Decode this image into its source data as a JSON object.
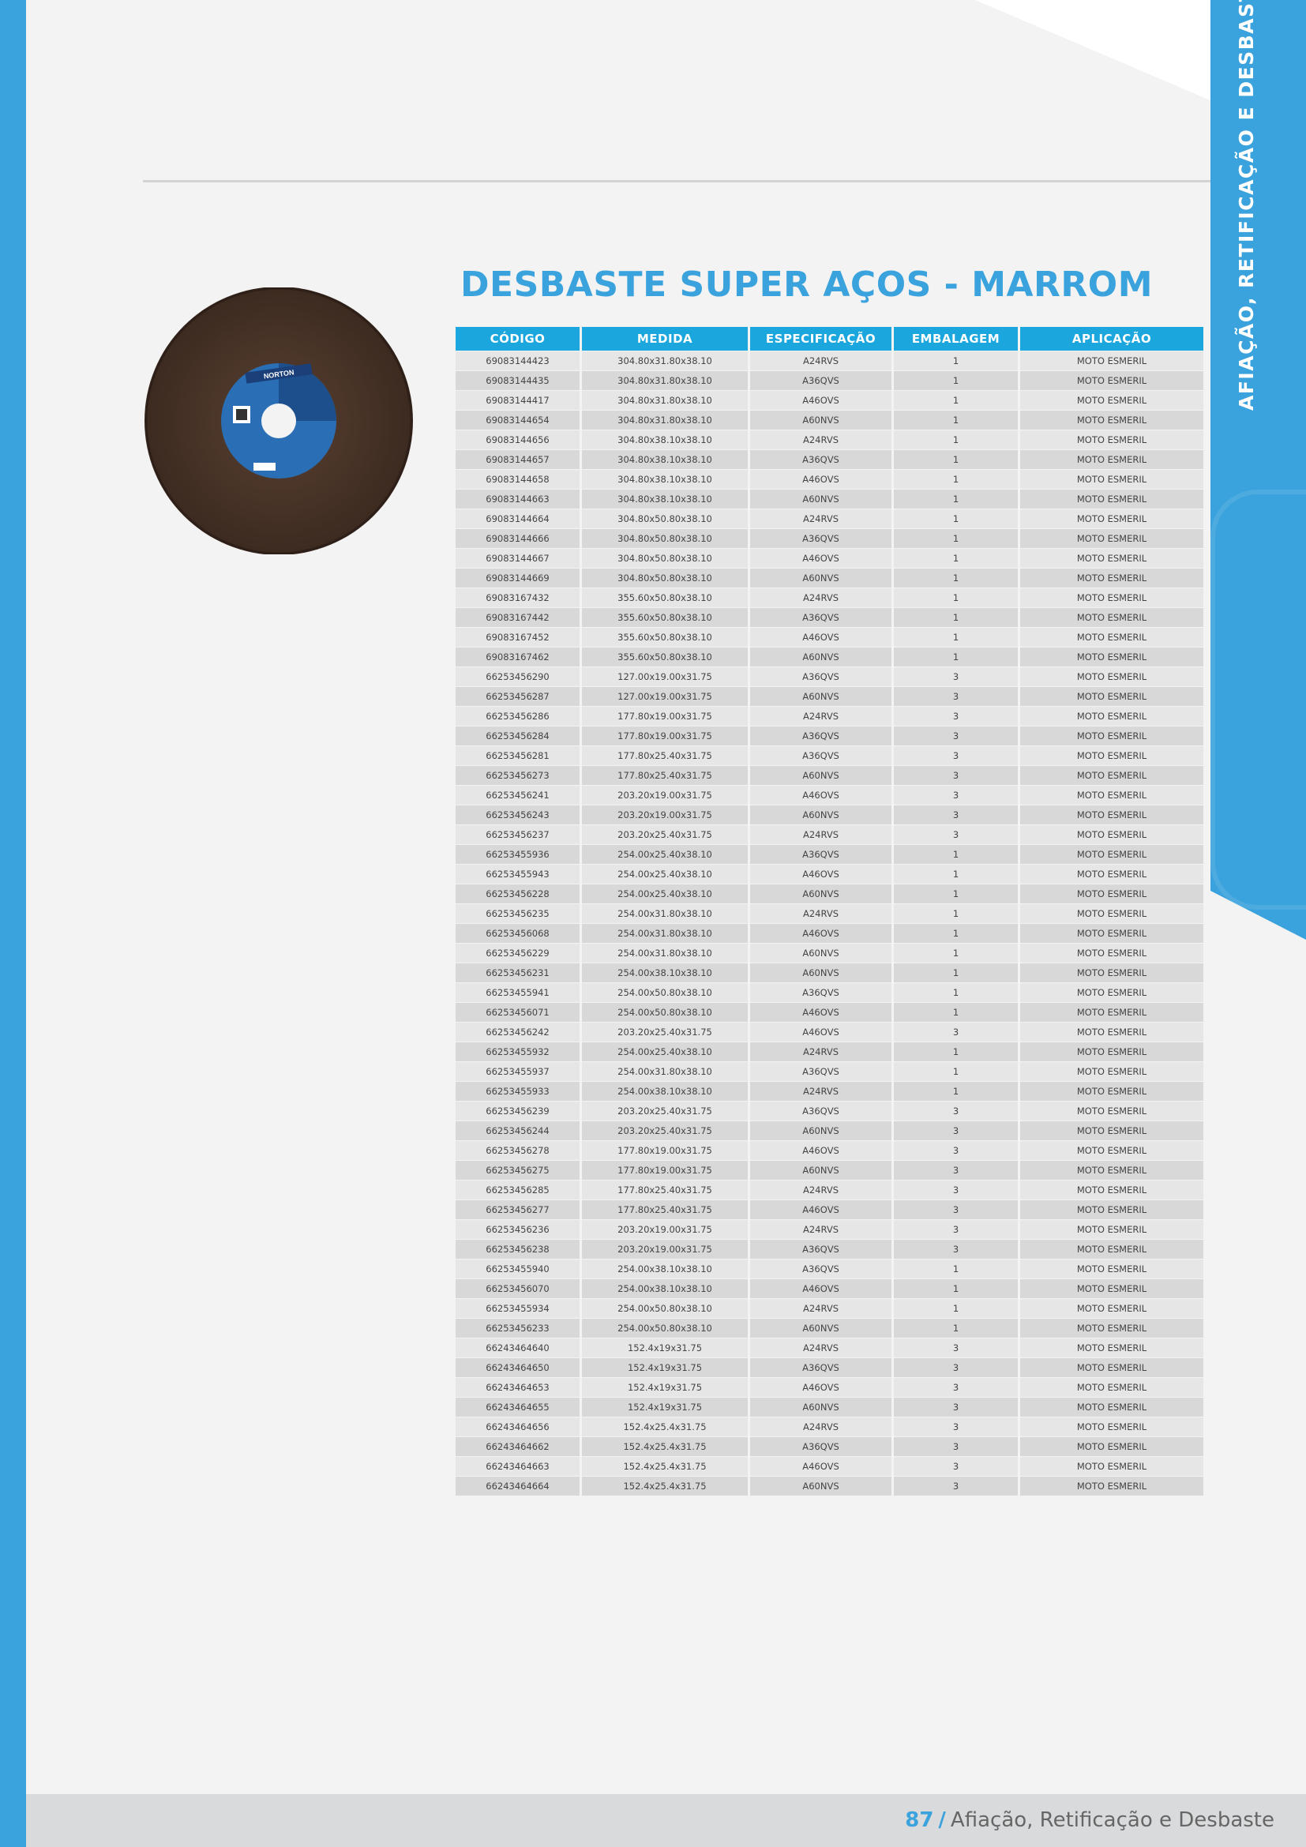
{
  "section_label": "AFIAÇÃO, RETIFICAÇÃO E DESBASTE",
  "title": "DESBASTE SUPER AÇOS - MARROM",
  "product_image": {
    "brand_text": "NORTON",
    "icon": "cutting-disc-image"
  },
  "table": {
    "headers": [
      "CÓDIGO",
      "MEDIDA",
      "ESPECIFICAÇÃO",
      "EMBALAGEM",
      "APLICAÇÃO"
    ],
    "rows": [
      [
        "69083144423",
        "304.80x31.80x38.10",
        "A24RVS",
        "1",
        "MOTO ESMERIL"
      ],
      [
        "69083144435",
        "304.80x31.80x38.10",
        "A36QVS",
        "1",
        "MOTO ESMERIL"
      ],
      [
        "69083144417",
        "304.80x31.80x38.10",
        "A46OVS",
        "1",
        "MOTO ESMERIL"
      ],
      [
        "69083144654",
        "304.80x31.80x38.10",
        "A60NVS",
        "1",
        "MOTO ESMERIL"
      ],
      [
        "69083144656",
        "304.80x38.10x38.10",
        "A24RVS",
        "1",
        "MOTO ESMERIL"
      ],
      [
        "69083144657",
        "304.80x38.10x38.10",
        "A36QVS",
        "1",
        "MOTO ESMERIL"
      ],
      [
        "69083144658",
        "304.80x38.10x38.10",
        "A46OVS",
        "1",
        "MOTO ESMERIL"
      ],
      [
        "69083144663",
        "304.80x38.10x38.10",
        "A60NVS",
        "1",
        "MOTO ESMERIL"
      ],
      [
        "69083144664",
        "304.80x50.80x38.10",
        "A24RVS",
        "1",
        "MOTO ESMERIL"
      ],
      [
        "69083144666",
        "304.80x50.80x38.10",
        "A36QVS",
        "1",
        "MOTO ESMERIL"
      ],
      [
        "69083144667",
        "304.80x50.80x38.10",
        "A46OVS",
        "1",
        "MOTO ESMERIL"
      ],
      [
        "69083144669",
        "304.80x50.80x38.10",
        "A60NVS",
        "1",
        "MOTO ESMERIL"
      ],
      [
        "69083167432",
        "355.60x50.80x38.10",
        "A24RVS",
        "1",
        "MOTO ESMERIL"
      ],
      [
        "69083167442",
        "355.60x50.80x38.10",
        "A36QVS",
        "1",
        "MOTO ESMERIL"
      ],
      [
        "69083167452",
        "355.60x50.80x38.10",
        "A46OVS",
        "1",
        "MOTO ESMERIL"
      ],
      [
        "69083167462",
        "355.60x50.80x38.10",
        "A60NVS",
        "1",
        "MOTO ESMERIL"
      ],
      [
        "66253456290",
        "127.00x19.00x31.75",
        "A36QVS",
        "3",
        "MOTO ESMERIL"
      ],
      [
        "66253456287",
        "127.00x19.00x31.75",
        "A60NVS",
        "3",
        "MOTO ESMERIL"
      ],
      [
        "66253456286",
        "177.80x19.00x31.75",
        "A24RVS",
        "3",
        "MOTO ESMERIL"
      ],
      [
        "66253456284",
        "177.80x19.00x31.75",
        "A36QVS",
        "3",
        "MOTO ESMERIL"
      ],
      [
        "66253456281",
        "177.80x25.40x31.75",
        "A36QVS",
        "3",
        "MOTO ESMERIL"
      ],
      [
        "66253456273",
        "177.80x25.40x31.75",
        "A60NVS",
        "3",
        "MOTO ESMERIL"
      ],
      [
        "66253456241",
        "203.20x19.00x31.75",
        "A46OVS",
        "3",
        "MOTO ESMERIL"
      ],
      [
        "66253456243",
        "203.20x19.00x31.75",
        "A60NVS",
        "3",
        "MOTO ESMERIL"
      ],
      [
        "66253456237",
        "203.20x25.40x31.75",
        "A24RVS",
        "3",
        "MOTO ESMERIL"
      ],
      [
        "66253455936",
        "254.00x25.40x38.10",
        "A36QVS",
        "1",
        "MOTO ESMERIL"
      ],
      [
        "66253455943",
        "254.00x25.40x38.10",
        "A46OVS",
        "1",
        "MOTO ESMERIL"
      ],
      [
        "66253456228",
        "254.00x25.40x38.10",
        "A60NVS",
        "1",
        "MOTO ESMERIL"
      ],
      [
        "66253456235",
        "254.00x31.80x38.10",
        "A24RVS",
        "1",
        "MOTO ESMERIL"
      ],
      [
        "66253456068",
        "254.00x31.80x38.10",
        "A46OVS",
        "1",
        "MOTO ESMERIL"
      ],
      [
        "66253456229",
        "254.00x31.80x38.10",
        "A60NVS",
        "1",
        "MOTO ESMERIL"
      ],
      [
        "66253456231",
        "254.00x38.10x38.10",
        "A60NVS",
        "1",
        "MOTO ESMERIL"
      ],
      [
        "66253455941",
        "254.00x50.80x38.10",
        "A36QVS",
        "1",
        "MOTO ESMERIL"
      ],
      [
        "66253456071",
        "254.00x50.80x38.10",
        "A46OVS",
        "1",
        "MOTO ESMERIL"
      ],
      [
        "66253456242",
        "203.20x25.40x31.75",
        "A46OVS",
        "3",
        "MOTO ESMERIL"
      ],
      [
        "66253455932",
        "254.00x25.40x38.10",
        "A24RVS",
        "1",
        "MOTO ESMERIL"
      ],
      [
        "66253455937",
        "254.00x31.80x38.10",
        "A36QVS",
        "1",
        "MOTO ESMERIL"
      ],
      [
        "66253455933",
        "254.00x38.10x38.10",
        "A24RVS",
        "1",
        "MOTO ESMERIL"
      ],
      [
        "66253456239",
        "203.20x25.40x31.75",
        "A36QVS",
        "3",
        "MOTO ESMERIL"
      ],
      [
        "66253456244",
        "203.20x25.40x31.75",
        "A60NVS",
        "3",
        "MOTO ESMERIL"
      ],
      [
        "66253456278",
        "177.80x19.00x31.75",
        "A46OVS",
        "3",
        "MOTO ESMERIL"
      ],
      [
        "66253456275",
        "177.80x19.00x31.75",
        "A60NVS",
        "3",
        "MOTO ESMERIL"
      ],
      [
        "66253456285",
        "177.80x25.40x31.75",
        "A24RVS",
        "3",
        "MOTO ESMERIL"
      ],
      [
        "66253456277",
        "177.80x25.40x31.75",
        "A46OVS",
        "3",
        "MOTO ESMERIL"
      ],
      [
        "66253456236",
        "203.20x19.00x31.75",
        "A24RVS",
        "3",
        "MOTO ESMERIL"
      ],
      [
        "66253456238",
        "203.20x19.00x31.75",
        "A36QVS",
        "3",
        "MOTO ESMERIL"
      ],
      [
        "66253455940",
        "254.00x38.10x38.10",
        "A36QVS",
        "1",
        "MOTO ESMERIL"
      ],
      [
        "66253456070",
        "254.00x38.10x38.10",
        "A46OVS",
        "1",
        "MOTO ESMERIL"
      ],
      [
        "66253455934",
        "254.00x50.80x38.10",
        "A24RVS",
        "1",
        "MOTO ESMERIL"
      ],
      [
        "66253456233",
        "254.00x50.80x38.10",
        "A60NVS",
        "1",
        "MOTO ESMERIL"
      ],
      [
        "66243464640",
        "152.4x19x31.75",
        "A24RVS",
        "3",
        "MOTO ESMERIL"
      ],
      [
        "66243464650",
        "152.4x19x31.75",
        "A36QVS",
        "3",
        "MOTO ESMERIL"
      ],
      [
        "66243464653",
        "152.4x19x31.75",
        "A46OVS",
        "3",
        "MOTO ESMERIL"
      ],
      [
        "66243464655",
        "152.4x19x31.75",
        "A60NVS",
        "3",
        "MOTO ESMERIL"
      ],
      [
        "66243464656",
        "152.4x25.4x31.75",
        "A24RVS",
        "3",
        "MOTO ESMERIL"
      ],
      [
        "66243464662",
        "152.4x25.4x31.75",
        "A36QVS",
        "3",
        "MOTO ESMERIL"
      ],
      [
        "66243464663",
        "152.4x25.4x31.75",
        "A46OVS",
        "3",
        "MOTO ESMERIL"
      ],
      [
        "66243464664",
        "152.4x25.4x31.75",
        "A60NVS",
        "3",
        "MOTO ESMERIL"
      ]
    ]
  },
  "footer": {
    "page_number": "87",
    "separator": "/",
    "section": "Afiação, Retificação e Desbaste"
  },
  "colors": {
    "accent": "#3aa2dc",
    "header_bg": "#1ba6de",
    "disc_brown": "#4a3528"
  }
}
